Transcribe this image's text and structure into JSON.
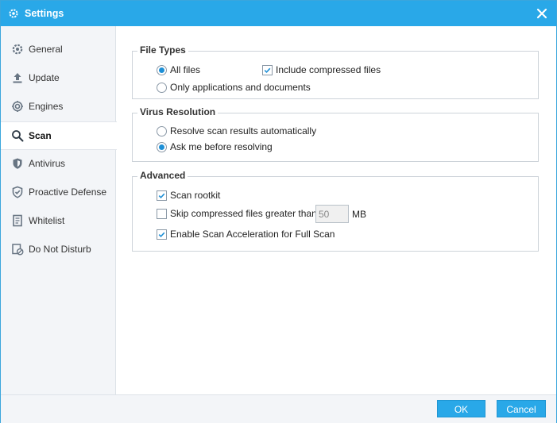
{
  "window": {
    "title": "Settings"
  },
  "sidebar": {
    "items": [
      {
        "label": "General",
        "icon": "gear-icon"
      },
      {
        "label": "Update",
        "icon": "upload-icon"
      },
      {
        "label": "Engines",
        "icon": "engine-icon"
      },
      {
        "label": "Scan",
        "icon": "search-icon",
        "active": true
      },
      {
        "label": "Antivirus",
        "icon": "shield-icon"
      },
      {
        "label": "Proactive Defense",
        "icon": "shield-check-icon"
      },
      {
        "label": "Whitelist",
        "icon": "document-icon"
      },
      {
        "label": "Do Not Disturb",
        "icon": "dnd-icon"
      }
    ]
  },
  "file_types": {
    "title": "File Types",
    "all_files": {
      "label": "All files",
      "checked": true
    },
    "include_compressed": {
      "label": "Include compressed files",
      "checked": true
    },
    "only_apps_docs": {
      "label": "Only applications and documents",
      "checked": false
    }
  },
  "virus_resolution": {
    "title": "Virus Resolution",
    "resolve_auto": {
      "label": "Resolve scan results automatically",
      "checked": false
    },
    "ask_me": {
      "label": "Ask me before resolving",
      "checked": true
    }
  },
  "advanced": {
    "title": "Advanced",
    "scan_rootkit": {
      "label": "Scan rootkit",
      "checked": true
    },
    "skip_compressed": {
      "label": "Skip compressed files greater than",
      "checked": false,
      "value": "50",
      "unit": "MB"
    },
    "scan_acceleration": {
      "label": "Enable Scan Acceleration for Full Scan",
      "checked": true
    }
  },
  "footer": {
    "ok_label": "OK",
    "cancel_label": "Cancel"
  },
  "colors": {
    "accent": "#29a8e8",
    "radio_dot": "#1d8fd6",
    "sidebar_bg": "#f3f5f8"
  }
}
